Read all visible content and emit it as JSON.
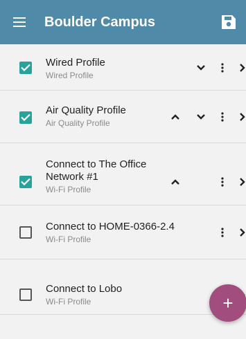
{
  "app_bar": {
    "title": "Boulder Campus",
    "menu_icon": "hamburger-menu-icon",
    "save_icon": "save-floppy-icon",
    "color": "#4f8aa8"
  },
  "profiles": [
    {
      "title": "Wired Profile",
      "subtitle": "Wired Profile",
      "checked": true,
      "controls": [
        "move-down",
        "more",
        "open"
      ]
    },
    {
      "title": "Air Quality Profile",
      "subtitle": "Air Quality Profile",
      "checked": true,
      "controls": [
        "move-up",
        "move-down",
        "more",
        "open"
      ]
    },
    {
      "title_line1": "Connect to The Office",
      "title_line2": "Network #1",
      "subtitle": "Wi-Fi Profile",
      "checked": true,
      "controls": [
        "move-up",
        "more",
        "open"
      ]
    },
    {
      "title": "Connect to HOME-0366-2.4",
      "subtitle": "Wi-Fi Profile",
      "checked": false,
      "controls": [
        "more",
        "open"
      ]
    },
    {
      "title": "Connect to Lobo",
      "subtitle": "Wi-Fi Profile",
      "checked": false,
      "controls": [
        "more",
        "open"
      ]
    }
  ],
  "fab": {
    "label": "+",
    "icon": "add-icon",
    "color": "#a14d7d"
  },
  "colors": {
    "checkbox_checked": "#2aa29c",
    "list_background": "#f2f2f2"
  }
}
